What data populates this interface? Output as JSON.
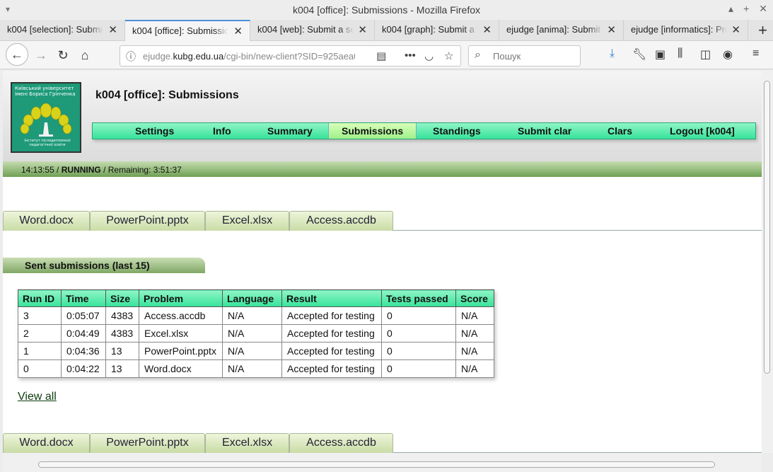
{
  "window": {
    "title": "k004 [office]: Submissions - Mozilla Firefox"
  },
  "tabs": [
    {
      "label": "k004 [selection]: Submis",
      "active": false
    },
    {
      "label": "k004 [office]: Submission",
      "active": true
    },
    {
      "label": "k004 [web]: Submit a solu",
      "active": false
    },
    {
      "label": "k004 [graph]: Submit a s",
      "active": false
    },
    {
      "label": "ejudge [anima]: Submit a",
      "active": false
    },
    {
      "label": "ejudge [informatics]: Pro",
      "active": false
    }
  ],
  "navbar": {
    "url_host": "ejudge.",
    "url_domain": "kubg.edu.ua",
    "url_path": "/cgi-bin/new-client?SID=925aea0",
    "search_placeholder": "Пошук"
  },
  "page": {
    "logo_text": "Київський університет імені Бориса Грінченка",
    "logo_subtext": "Інститут післядипломної педагогічної освіти",
    "contest_title": "k004 [office]: Submissions",
    "menu": [
      {
        "label": "Settings"
      },
      {
        "label": "Info"
      },
      {
        "label": "Summary"
      },
      {
        "label": "Submissions"
      },
      {
        "label": "Standings"
      },
      {
        "label": "Submit clar"
      },
      {
        "label": "Clars"
      },
      {
        "label": "Logout [k004]"
      }
    ],
    "status": {
      "time": "14:13:55",
      "separator1": " / ",
      "state": "RUNNING",
      "remaining_label": " / Remaining: ",
      "remaining": "3:51:37"
    },
    "file_tabs": [
      "Word.docx",
      "PowerPoint.pptx",
      "Excel.xlsx",
      "Access.accdb"
    ],
    "section_title": "Sent submissions (last 15)",
    "table": {
      "headers": [
        "Run ID",
        "Time",
        "Size",
        "Problem",
        "Language",
        "Result",
        "Tests passed",
        "Score"
      ],
      "rows": [
        [
          "3",
          "0:05:07",
          "4383",
          "Access.accdb",
          "N/A",
          "Accepted for testing",
          "0",
          "N/A"
        ],
        [
          "2",
          "0:04:49",
          "4383",
          "Excel.xlsx",
          "N/A",
          "Accepted for testing",
          "0",
          "N/A"
        ],
        [
          "1",
          "0:04:36",
          "13",
          "PowerPoint.pptx",
          "N/A",
          "Accepted for testing",
          "0",
          "N/A"
        ],
        [
          "0",
          "0:04:22",
          "13",
          "Word.docx",
          "N/A",
          "Accepted for testing",
          "0",
          "N/A"
        ]
      ]
    },
    "view_all": "View all"
  },
  "colors": {
    "menu_green": "#37e39a",
    "status_green": "#6ea054",
    "tab_accent": "#4a90d9"
  }
}
